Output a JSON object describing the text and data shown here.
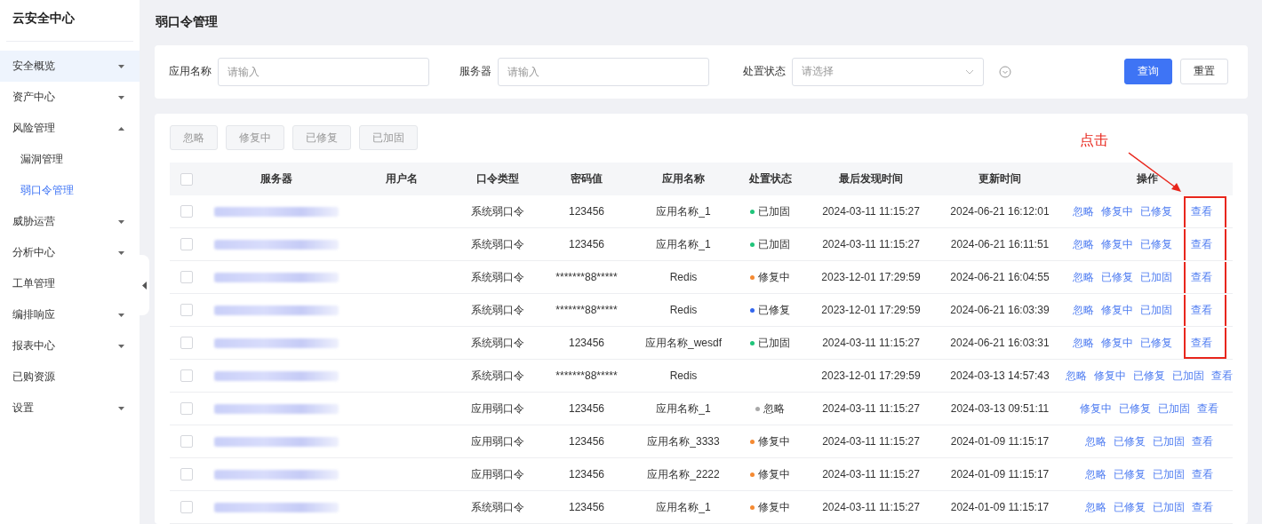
{
  "sidebar": {
    "title": "云安全中心",
    "items": [
      {
        "kind": "menu",
        "label": "安全概览",
        "highlighted": true,
        "expanded": false
      },
      {
        "kind": "menu",
        "label": "资产中心",
        "highlighted": false,
        "expanded": false
      },
      {
        "kind": "menu",
        "label": "风险管理",
        "highlighted": false,
        "expanded": true,
        "children": [
          {
            "label": "漏洞管理",
            "selected": false
          },
          {
            "label": "弱口令管理",
            "selected": true
          }
        ]
      },
      {
        "kind": "menu",
        "label": "威胁运营",
        "highlighted": false,
        "expanded": false
      },
      {
        "kind": "menu",
        "label": "分析中心",
        "highlighted": false,
        "expanded": false
      },
      {
        "kind": "link",
        "label": "工单管理",
        "highlighted": false
      },
      {
        "kind": "menu",
        "label": "编排响应",
        "highlighted": false,
        "expanded": false
      },
      {
        "kind": "menu",
        "label": "报表中心",
        "highlighted": false,
        "expanded": false
      },
      {
        "kind": "link",
        "label": "已购资源",
        "highlighted": false
      },
      {
        "kind": "menu",
        "label": "设置",
        "highlighted": false,
        "expanded": false
      }
    ]
  },
  "page_title": "弱口令管理",
  "filters": [
    {
      "kind": "input",
      "label": "应用名称",
      "placeholder": "请输入"
    },
    {
      "kind": "input",
      "label": "服务器",
      "placeholder": "请输入"
    },
    {
      "kind": "select",
      "label": "处置状态",
      "placeholder": "请选择"
    }
  ],
  "filter_buttons": [
    {
      "label": "查询",
      "primary": true
    },
    {
      "label": "重置",
      "primary": false
    }
  ],
  "bulk_buttons": [
    {
      "label": "忽略",
      "disabled": true
    },
    {
      "label": "修复中",
      "disabled": true
    },
    {
      "label": "已修复",
      "disabled": true
    },
    {
      "label": "已加固",
      "disabled": true
    }
  ],
  "table": {
    "all_checked": false,
    "columns": [
      "服务器",
      "用户名",
      "口令类型",
      "密码值",
      "应用名称",
      "处置状态",
      "最后发现时间",
      "更新时间",
      "操作"
    ],
    "rows": [
      {
        "checked": false,
        "highlighted": true,
        "type": "系统弱口令",
        "password": "123456",
        "app": "应用名称_1",
        "status": {
          "label": "已加固",
          "color": "#1fc47a"
        },
        "last_seen": "2024-03-11 11:15:27",
        "updated": "2024-06-21 16:12:01",
        "actions": [
          "忽略",
          "修复中",
          "已修复",
          "查看"
        ]
      },
      {
        "checked": false,
        "highlighted": true,
        "type": "系统弱口令",
        "password": "123456",
        "app": "应用名称_1",
        "status": {
          "label": "已加固",
          "color": "#1fc47a"
        },
        "last_seen": "2024-03-11 11:15:27",
        "updated": "2024-06-21 16:11:51",
        "actions": [
          "忽略",
          "修复中",
          "已修复",
          "查看"
        ]
      },
      {
        "checked": false,
        "highlighted": true,
        "type": "系统弱口令",
        "password": "*******88*****",
        "app": "Redis",
        "status": {
          "label": "修复中",
          "color": "#f58a32"
        },
        "last_seen": "2023-12-01 17:29:59",
        "updated": "2024-06-21 16:04:55",
        "actions": [
          "忽略",
          "已修复",
          "已加固",
          "查看"
        ]
      },
      {
        "checked": false,
        "highlighted": true,
        "type": "系统弱口令",
        "password": "*******88*****",
        "app": "Redis",
        "status": {
          "label": "已修复",
          "color": "#3366ee"
        },
        "last_seen": "2023-12-01 17:29:59",
        "updated": "2024-06-21 16:03:39",
        "actions": [
          "忽略",
          "修复中",
          "已加固",
          "查看"
        ]
      },
      {
        "checked": false,
        "highlighted": true,
        "type": "系统弱口令",
        "password": "123456",
        "app": "应用名称_wesdf",
        "status": {
          "label": "已加固",
          "color": "#1fc47a"
        },
        "last_seen": "2024-03-11 11:15:27",
        "updated": "2024-06-21 16:03:31",
        "actions": [
          "忽略",
          "修复中",
          "已修复",
          "查看"
        ]
      },
      {
        "checked": false,
        "highlighted": false,
        "type": "系统弱口令",
        "password": "*******88*****",
        "app": "Redis",
        "last_seen": "2023-12-01 17:29:59",
        "updated": "2024-03-13 14:57:43",
        "actions": [
          "忽略",
          "修复中",
          "已修复",
          "已加固",
          "查看"
        ]
      },
      {
        "checked": false,
        "highlighted": false,
        "type": "应用弱口令",
        "password": "123456",
        "app": "应用名称_1",
        "status": {
          "label": "忽略",
          "color": "#a8a8a8"
        },
        "last_seen": "2024-03-11 11:15:27",
        "updated": "2024-03-13 09:51:11",
        "actions": [
          "修复中",
          "已修复",
          "已加固",
          "查看"
        ]
      },
      {
        "checked": false,
        "highlighted": false,
        "type": "应用弱口令",
        "password": "123456",
        "app": "应用名称_3333",
        "status": {
          "label": "修复中",
          "color": "#f58a32"
        },
        "last_seen": "2024-03-11 11:15:27",
        "updated": "2024-01-09 11:15:17",
        "actions": [
          "忽略",
          "已修复",
          "已加固",
          "查看"
        ]
      },
      {
        "checked": false,
        "highlighted": false,
        "type": "应用弱口令",
        "password": "123456",
        "app": "应用名称_2222",
        "status": {
          "label": "修复中",
          "color": "#f58a32"
        },
        "last_seen": "2024-03-11 11:15:27",
        "updated": "2024-01-09 11:15:17",
        "actions": [
          "忽略",
          "已修复",
          "已加固",
          "查看"
        ]
      },
      {
        "checked": false,
        "highlighted": false,
        "type": "系统弱口令",
        "password": "123456",
        "app": "应用名称_1",
        "status": {
          "label": "修复中",
          "color": "#f58a32"
        },
        "last_seen": "2024-03-11 11:15:27",
        "updated": "2024-01-09 11:15:17",
        "actions": [
          "忽略",
          "已修复",
          "已加固",
          "查看"
        ]
      }
    ]
  },
  "annotation": {
    "label": "点击"
  }
}
